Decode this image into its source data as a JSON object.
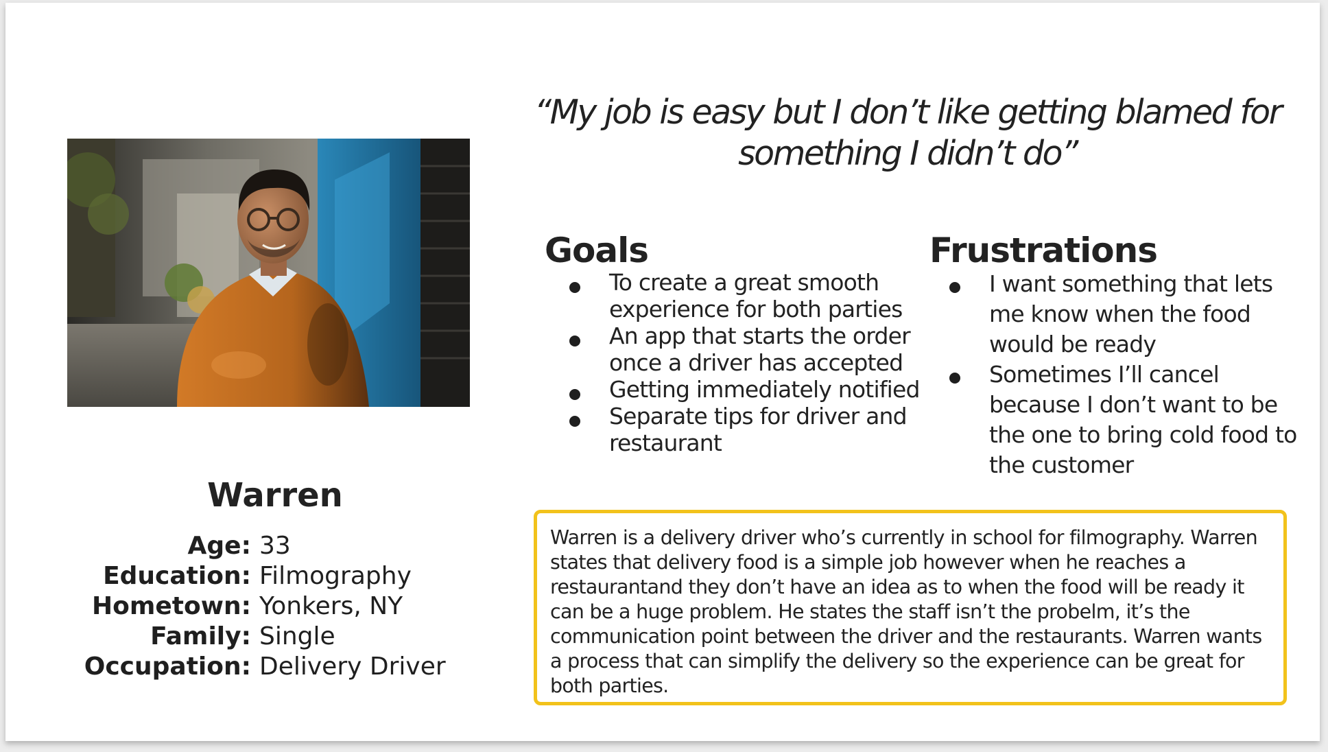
{
  "persona": {
    "name": "Warren",
    "quote": "“My job is easy but I don’t like getting blamed for something I didn’t do”",
    "details": [
      {
        "label": "Age:",
        "value": "33"
      },
      {
        "label": "Education:",
        "value": "Filmography"
      },
      {
        "label": "Hometown:",
        "value": "Yonkers, NY"
      },
      {
        "label": "Family:",
        "value": "Single"
      },
      {
        "label": "Occupation:",
        "value": "Delivery Driver"
      }
    ]
  },
  "goals": {
    "title": "Goals",
    "items": [
      "To create a great smooth experience for both parties",
      "An app that starts the order once a driver has accepted",
      "Getting immediately notified",
      "Separate tips for driver and restaurant"
    ]
  },
  "frustrations": {
    "title": "Frustrations",
    "items": [
      "I want something that lets me know when the food would be ready",
      "Sometimes I’ll cancel because I don’t want to be the one to bring cold food to the customer"
    ]
  },
  "bio": {
    "text": "Warren is a delivery driver who’s currently in school for filmography. Warren states that delivery food is a simple job however when he reaches a restaurantand they don’t have an idea as to when the food will be ready it can be a huge problem. He states the staff isn’t the probelm, it’s the communication point between the driver and the restaurants. Warren wants a process that can simplify the delivery so the experience can be great for both parties."
  },
  "colors": {
    "bio_border": "#f2c21b",
    "sweater": "#b5651d",
    "wall_blue": "#1f6f9a"
  }
}
